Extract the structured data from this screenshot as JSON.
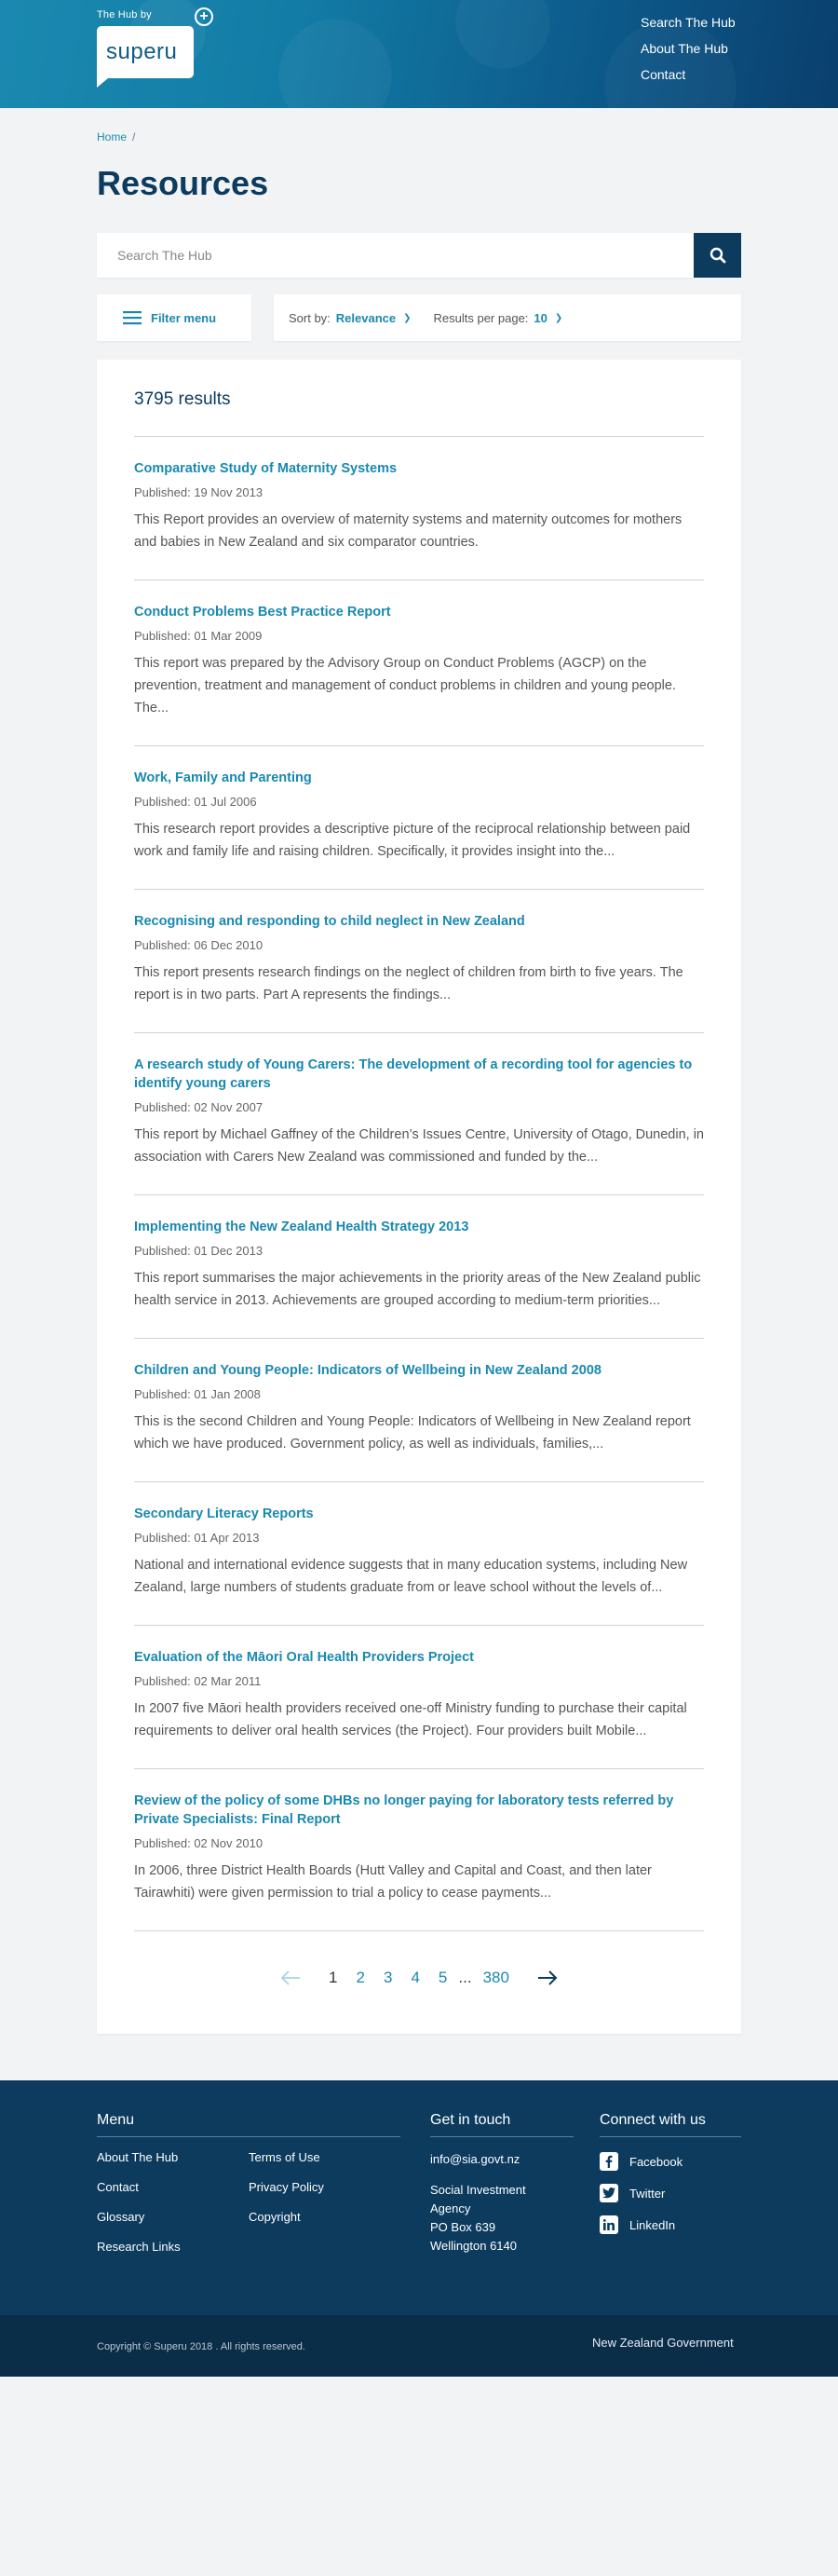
{
  "header": {
    "tagline": "The Hub by",
    "logo": "superu",
    "nav": [
      "Search The Hub",
      "About The Hub",
      "Contact"
    ]
  },
  "breadcrumb": {
    "home": "Home",
    "sep": "/"
  },
  "page_title": "Resources",
  "search": {
    "placeholder": "Search The Hub",
    "value": ""
  },
  "controls": {
    "filter_label": "Filter menu",
    "sort_label": "Sort by:",
    "sort_value": "Relevance",
    "per_page_label": "Results per page:",
    "per_page_value": "10"
  },
  "results_count": "3795 results",
  "results": [
    {
      "title": "Comparative Study of Maternity Systems",
      "date": "Published: 19 Nov 2013",
      "desc": "This Report provides an overview of maternity systems and maternity outcomes for mothers and babies in New Zealand and six comparator countries."
    },
    {
      "title": "Conduct Problems Best Practice Report",
      "date": "Published: 01 Mar 2009",
      "desc": "This report was prepared by the Advisory Group on Conduct Problems (AGCP) on the prevention, treatment and management of conduct problems in children and young people. The..."
    },
    {
      "title": "Work, Family and Parenting",
      "date": "Published: 01 Jul 2006",
      "desc": "This research report provides a descriptive picture of the reciprocal relationship between paid work and family life and raising children. Specifically, it provides insight into the..."
    },
    {
      "title": "Recognising and responding to child neglect in New Zealand",
      "date": "Published: 06 Dec 2010",
      "desc": "This report presents research findings on the neglect of children from birth to five years. The report is in two parts. Part A represents the findings..."
    },
    {
      "title": "A research study of Young Carers: The development of a recording tool for agencies to identify young carers",
      "date": "Published: 02 Nov 2007",
      "desc": "This report by Michael Gaffney of the Children’s Issues Centre, University of Otago, Dunedin, in association with Carers New Zealand was commissioned and funded by the..."
    },
    {
      "title": "Implementing the New Zealand Health Strategy 2013",
      "date": "Published: 01 Dec 2013",
      "desc": "This report summarises the major achievements in the priority areas of the New Zealand public health service in 2013. Achievements are grouped according to medium-term priorities..."
    },
    {
      "title": "Children and Young People: Indicators of Wellbeing in New Zealand 2008",
      "date": "Published: 01 Jan 2008",
      "desc": "This is the second Children and Young People: Indicators of Wellbeing in New Zealand report which we have produced. Government policy, as well as individuals, families,..."
    },
    {
      "title": "Secondary Literacy Reports",
      "date": "Published: 01 Apr 2013",
      "desc": "National and international evidence suggests that in many education systems, including New Zealand, large numbers of students graduate from or leave school without the levels of..."
    },
    {
      "title": "Evaluation of the Māori Oral Health Providers Project",
      "date": "Published: 02 Mar 2011",
      "desc": "In 2007 five Māori health providers received one-off Ministry funding to purchase their capital requirements to deliver oral health services (the Project). Four providers built Mobile..."
    },
    {
      "title": "Review of the policy of some DHBs no longer paying for laboratory tests referred by Private Specialists: Final Report",
      "date": "Published: 02 Nov 2010",
      "desc": "In 2006, three District Health Boards (Hutt Valley and Capital and Coast, and then later Tairawhiti) were given permission to trial a policy to cease payments..."
    }
  ],
  "pagination": {
    "pages": [
      "1",
      "2",
      "3",
      "4",
      "5"
    ],
    "current": "1",
    "ellipsis": "...",
    "last": "380"
  },
  "footer": {
    "menu_title": "Menu",
    "menu_col1": [
      "About The Hub",
      "Contact",
      "Glossary",
      "Research Links"
    ],
    "menu_col2": [
      "Terms of Use",
      "Privacy Policy",
      "Copyright"
    ],
    "contact_title": "Get in touch",
    "email": "info@sia.govt.nz",
    "address": [
      "Social Investment",
      "Agency",
      "PO Box 639",
      "Wellington 6140"
    ],
    "social_title": "Connect with us",
    "social": [
      {
        "label": "Facebook",
        "icon": "facebook-icon"
      },
      {
        "label": "Twitter",
        "icon": "twitter-icon"
      },
      {
        "label": "LinkedIn",
        "icon": "linkedin-icon"
      }
    ],
    "copyright": "Copyright © Superu 2018 . All rights reserved.",
    "gov_brand": "New Zealand Government"
  },
  "colors": {
    "accent": "#1a89b0",
    "navy": "#0c3b5e",
    "footer_bottom": "#0a2d48"
  }
}
